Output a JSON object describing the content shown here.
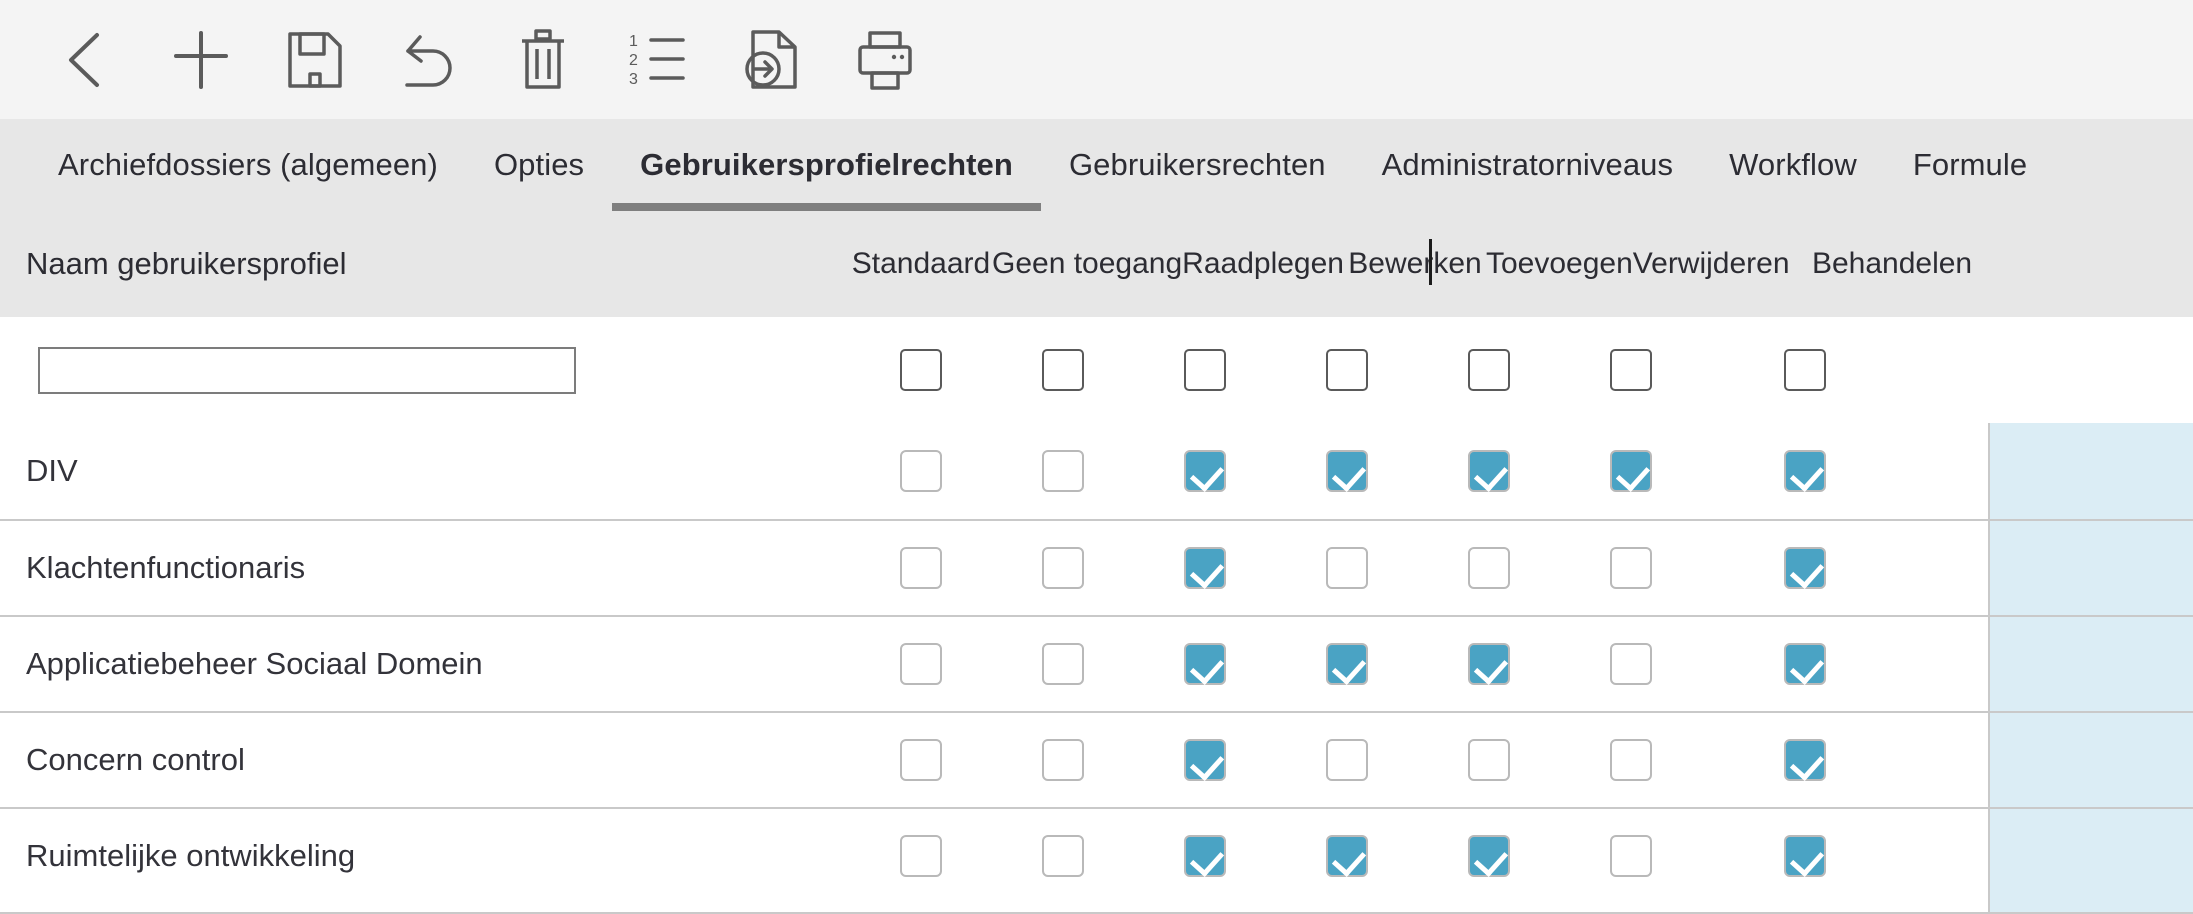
{
  "toolbar": {
    "buttons": [
      {
        "name": "back-icon",
        "label": "Terug"
      },
      {
        "name": "add-icon",
        "label": "Nieuw"
      },
      {
        "name": "save-icon",
        "label": "Opslaan"
      },
      {
        "name": "undo-icon",
        "label": "Ongedaan maken"
      },
      {
        "name": "delete-icon",
        "label": "Verwijderen"
      },
      {
        "name": "numbered-list-icon",
        "label": "Nummering"
      },
      {
        "name": "export-document-icon",
        "label": "Exporteren"
      },
      {
        "name": "print-icon",
        "label": "Afdrukken"
      }
    ]
  },
  "tabs": [
    {
      "label": "Archiefdossiers (algemeen)",
      "active": false
    },
    {
      "label": "Opties",
      "active": false
    },
    {
      "label": "Gebruikersprofielrechten",
      "active": true
    },
    {
      "label": "Gebruikersrechten",
      "active": false
    },
    {
      "label": "Administratorniveaus",
      "active": false
    },
    {
      "label": "Workflow",
      "active": false
    },
    {
      "label": "Formule",
      "active": false
    }
  ],
  "grid": {
    "name_column_header": "Naam gebruikersprofiel",
    "columns": [
      "Standaard",
      "Geen toegang",
      "Raadplegen",
      "Bewerken",
      "Toevoegen",
      "Verwijderen",
      "Behandelen"
    ],
    "highlighted_column": "Behandelen",
    "filter_row": {
      "name_value": "",
      "name_placeholder": "",
      "checks": [
        false,
        false,
        false,
        false,
        false,
        false,
        false
      ]
    },
    "rows": [
      {
        "name": "DIV",
        "checks": [
          false,
          false,
          true,
          true,
          true,
          true,
          true
        ]
      },
      {
        "name": "Klachtenfunctionaris",
        "checks": [
          false,
          false,
          true,
          false,
          false,
          false,
          true
        ]
      },
      {
        "name": "Applicatiebeheer Sociaal Domein",
        "checks": [
          false,
          false,
          true,
          true,
          true,
          false,
          true
        ]
      },
      {
        "name": "Concern control",
        "checks": [
          false,
          false,
          true,
          false,
          false,
          false,
          true
        ]
      },
      {
        "name": "Ruimtelijke ontwikkeling",
        "checks": [
          false,
          false,
          true,
          true,
          true,
          false,
          true
        ]
      }
    ]
  },
  "colors": {
    "checked": "#4aa3c4",
    "highlight_column": "#dbedf5",
    "header_band": "#e7e7e7",
    "toolbar": "#f4f4f4",
    "active_tab_underline": "#7f7f7f"
  }
}
